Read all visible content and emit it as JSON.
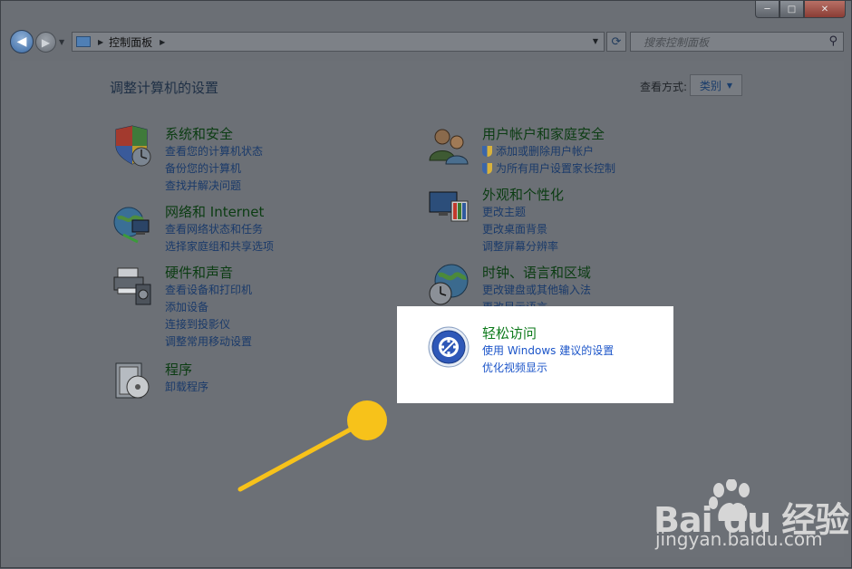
{
  "window": {
    "caption": {
      "minimize": "─",
      "maximize": "□",
      "close": "✕"
    }
  },
  "nav": {
    "back_glyph": "◀",
    "forward_glyph": "▶",
    "address": {
      "breadcrumb": "控制面板"
    },
    "search": {
      "placeholder": "搜索控制面板"
    }
  },
  "main": {
    "heading": "调整计算机的设置",
    "view_by_label": "查看方式:",
    "view_by_value": "类别"
  },
  "categories_left": [
    {
      "title": "系统和安全",
      "links": [
        "查看您的计算机状态",
        "备份您的计算机",
        "查找并解决问题"
      ]
    },
    {
      "title": "网络和 Internet",
      "links": [
        "查看网络状态和任务",
        "选择家庭组和共享选项"
      ]
    },
    {
      "title": "硬件和声音",
      "links": [
        "查看设备和打印机",
        "添加设备",
        "连接到投影仪",
        "调整常用移动设置"
      ]
    },
    {
      "title": "程序",
      "links": [
        "卸载程序"
      ]
    }
  ],
  "categories_right": [
    {
      "title": "用户帐户和家庭安全",
      "links": [
        "添加或删除用户帐户",
        "为所有用户设置家长控制"
      ]
    },
    {
      "title": "外观和个性化",
      "links": [
        "更改主题",
        "更改桌面背景",
        "调整屏幕分辨率"
      ]
    },
    {
      "title": "时钟、语言和区域",
      "links": [
        "更改键盘或其他输入法",
        "更改显示语言"
      ]
    }
  ],
  "highlight": {
    "title": "轻松访问",
    "links": [
      "使用 Windows 建议的设置",
      "优化视频显示"
    ]
  },
  "watermark": {
    "brand": "Bai du 经验",
    "site": "jingyan.baidu.com"
  },
  "colors": {
    "overlay": "#6c7076",
    "highlight_bg": "#ffffff",
    "pointer": "#f7c21a",
    "link": "#1c55c9",
    "title_green": "#0d7a1b"
  }
}
